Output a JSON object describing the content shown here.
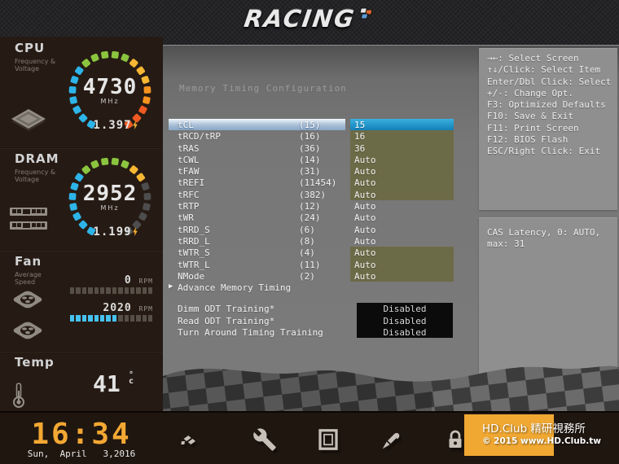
{
  "logo": {
    "text": "RACING",
    "flag_icon": "checkered-flag-icon"
  },
  "colors": {
    "accent_blue": "#1e9cd7",
    "value_olive": "#6c6b47",
    "selected_bar": "#aabfd6",
    "clock_orange": "#f3a833",
    "watermark_orange": "#f0a832",
    "fan_bar_active": "#45c2ef"
  },
  "sidebar": {
    "cpu": {
      "title": "CPU",
      "sub1": "Frequency &",
      "sub2": "Voltage",
      "value": "4730",
      "unit": "MHz",
      "voltage": "1.397",
      "gauge_colors": [
        "#2db4e8",
        "#2db4e8",
        "#2db4e8",
        "#2db4e8",
        "#2db4e8",
        "#2db4e8",
        "#2db4e8",
        "#8bc53f",
        "#8bc53f",
        "#8bc53f",
        "#8bc53f",
        "#8bc53f",
        "#f7b733",
        "#f7b733",
        "#f7b733",
        "#f6921e",
        "#f6921e",
        "#f15a24",
        "#f15a24",
        "#f15a24"
      ]
    },
    "dram": {
      "title": "DRAM",
      "sub1": "Frequency &",
      "sub2": "Voltage",
      "value": "2952",
      "unit": "MHz",
      "voltage": "1.199",
      "gauge_colors": [
        "#2db4e8",
        "#2db4e8",
        "#2db4e8",
        "#2db4e8",
        "#2db4e8",
        "#2db4e8",
        "#2db4e8",
        "#8bc53f",
        "#8bc53f",
        "#8bc53f",
        "#8bc53f",
        "#8bc53f",
        "#f7b733",
        "#f7b733",
        "#4d4d4d",
        "#4d4d4d",
        "#4d4d4d",
        "#4d4d4d",
        "#4d4d4d",
        "#4d4d4d"
      ]
    },
    "fan": {
      "title": "Fan",
      "sub1": "Average",
      "sub2": "Speed",
      "fans": [
        {
          "rpm": "0",
          "unit": "RPM",
          "bars_total": 14,
          "bars_active": 0
        },
        {
          "rpm": "2020",
          "unit": "RPM",
          "bars_total": 14,
          "bars_active": 8
        }
      ]
    },
    "temp": {
      "title": "Temp",
      "value": "41",
      "deg": "°",
      "unit": "c"
    }
  },
  "main": {
    "title": "Memory Timing Configuration",
    "rows": [
      {
        "label": "tCL",
        "paren": "(15)",
        "value": "15",
        "state": "selected"
      },
      {
        "label": "tRCD/tRP",
        "paren": "(16)",
        "value": "16",
        "state": "olive"
      },
      {
        "label": "tRAS",
        "paren": "(36)",
        "value": "36",
        "state": "olive"
      },
      {
        "label": "tCWL",
        "paren": "(14)",
        "value": "Auto",
        "state": "olive"
      },
      {
        "label": "tFAW",
        "paren": "(31)",
        "value": "Auto",
        "state": "olive"
      },
      {
        "label": "tREFI",
        "paren": "(11454)",
        "value": "Auto",
        "state": "olive"
      },
      {
        "label": "tRFC",
        "paren": "(382)",
        "value": "Auto",
        "state": "olive"
      },
      {
        "label": "tRTP",
        "paren": "(12)",
        "value": "Auto",
        "state": "plain"
      },
      {
        "label": "tWR",
        "paren": "(24)",
        "value": "Auto",
        "state": "plain"
      },
      {
        "label": "tRRD_S",
        "paren": "(6)",
        "value": "Auto",
        "state": "plain"
      },
      {
        "label": "tRRD_L",
        "paren": "(8)",
        "value": "Auto",
        "state": "plain"
      },
      {
        "label": "tWTR_S",
        "paren": "(4)",
        "value": "Auto",
        "state": "olive"
      },
      {
        "label": "tWTR_L",
        "paren": "(11)",
        "value": "Auto",
        "state": "olive"
      },
      {
        "label": "NMode",
        "paren": "(2)",
        "value": "Auto",
        "state": "olive"
      }
    ],
    "advance_marker": "▶",
    "advance_label": "Advance Memory Timing",
    "training_rows": [
      {
        "label": "Dimm ODT Training*",
        "value": "Disabled"
      },
      {
        "label": "Read ODT Training*",
        "value": "Disabled"
      },
      {
        "label": "Turn Around Timing Training",
        "value": "Disabled"
      }
    ]
  },
  "help": {
    "lines": [
      "→←: Select Screen",
      "↑↓/Click: Select Item",
      "Enter/Dbl Click: Select",
      "+/-: Change Opt.",
      "F3: Optimized Defaults",
      "F10: Save & Exit",
      "F11: Print Screen",
      "F12: BIOS Flash",
      "ESC/Right Click: Exit"
    ]
  },
  "info": {
    "lines": [
      "CAS Latency, 0: AUTO,",
      "max: 31"
    ]
  },
  "footer": {
    "time": "16:34",
    "date": "Sun,  April   3,2016",
    "menu_icons": [
      "racing-flag-icon",
      "wrench-icon",
      "monitor-icon",
      "screwdriver-icon",
      "lock-icon"
    ],
    "watermark_line1": "HD.Club 精研視務所",
    "watermark_line2": "© 2015 www.HD.Club.tw"
  }
}
